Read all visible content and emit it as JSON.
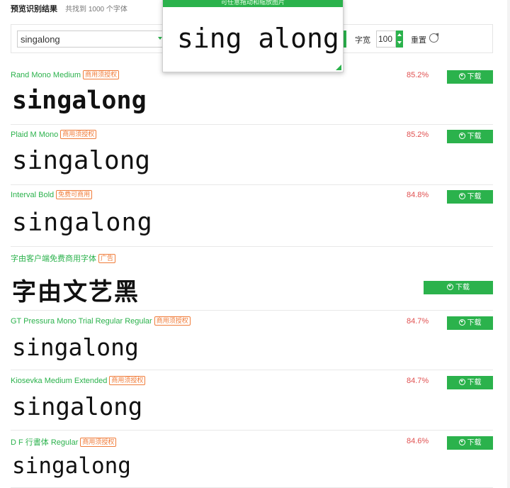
{
  "header": {
    "title": "预览识别结果",
    "count_text": "共找到 1000 个字体"
  },
  "toolbar": {
    "text_value": "singalong",
    "width_label": "字宽",
    "width_value": "100",
    "reset_label": "重置"
  },
  "preview": {
    "hint": "可任意拖动和缩放图片",
    "text": "sing along"
  },
  "results": [
    {
      "name": "Rand Mono Medium",
      "tag": "商用须授权",
      "score": "85.2%",
      "download": "下载",
      "sample": "singalong"
    },
    {
      "name": "Plaid M Mono",
      "tag": "商用须授权",
      "score": "85.2%",
      "download": "下载",
      "sample": "singalong"
    },
    {
      "name": "Interval Bold",
      "tag": "免费可商用",
      "score": "84.8%",
      "download": "下载",
      "sample": "singalong"
    },
    {
      "name": "字由客户端免费商用字体",
      "tag": "广告",
      "score": "",
      "download": "下载",
      "sample": "字由文艺黑"
    },
    {
      "name": "GT Pressura Mono Trial Regular Regular",
      "tag": "商用须授权",
      "score": "84.7%",
      "download": "下载",
      "sample": "singalong"
    },
    {
      "name": "Kiosevka Medium Extended",
      "tag": "商用须授权",
      "score": "84.7%",
      "download": "下载",
      "sample": "singalong"
    },
    {
      "name": "D F 行書体 Regular",
      "tag": "商用须授权",
      "score": "84.6%",
      "download": "下载",
      "sample": "singalong"
    }
  ],
  "colors": {
    "accent": "#2bb24c",
    "score": "#e05050",
    "tag": "#f07c3a"
  }
}
